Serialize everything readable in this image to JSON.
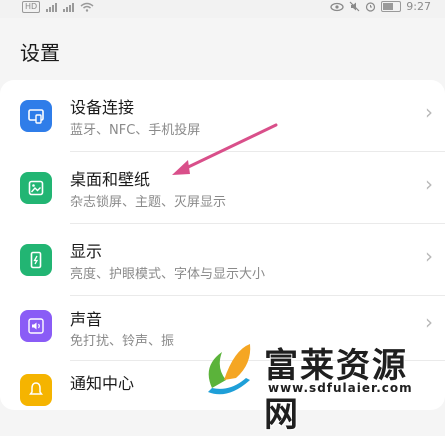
{
  "status_bar": {
    "hd_label": "HD",
    "time": "9:27"
  },
  "header": {
    "title": "设置"
  },
  "settings": [
    {
      "title": "设备连接",
      "subtitle": "蓝牙、NFC、手机投屏",
      "icon": "device-connect-icon",
      "color": "#2f7de9"
    },
    {
      "title": "桌面和壁纸",
      "subtitle": "杂志锁屏、主题、灭屏显示",
      "icon": "wallpaper-icon",
      "color": "#22b573"
    },
    {
      "title": "显示",
      "subtitle": "亮度、护眼模式、字体与显示大小",
      "icon": "display-icon",
      "color": "#22b573"
    },
    {
      "title": "声音",
      "subtitle": "免打扰、铃声、振",
      "icon": "sound-icon",
      "color": "#8a5cf6"
    },
    {
      "title": "通知中心",
      "subtitle": "",
      "icon": "notification-icon",
      "color": "#f5b400"
    }
  ],
  "chevron": "›",
  "annotation": {
    "color": "#d94f8a"
  },
  "watermark": {
    "brand": "富莱资源网",
    "url": "www.sdfulaier.com"
  }
}
